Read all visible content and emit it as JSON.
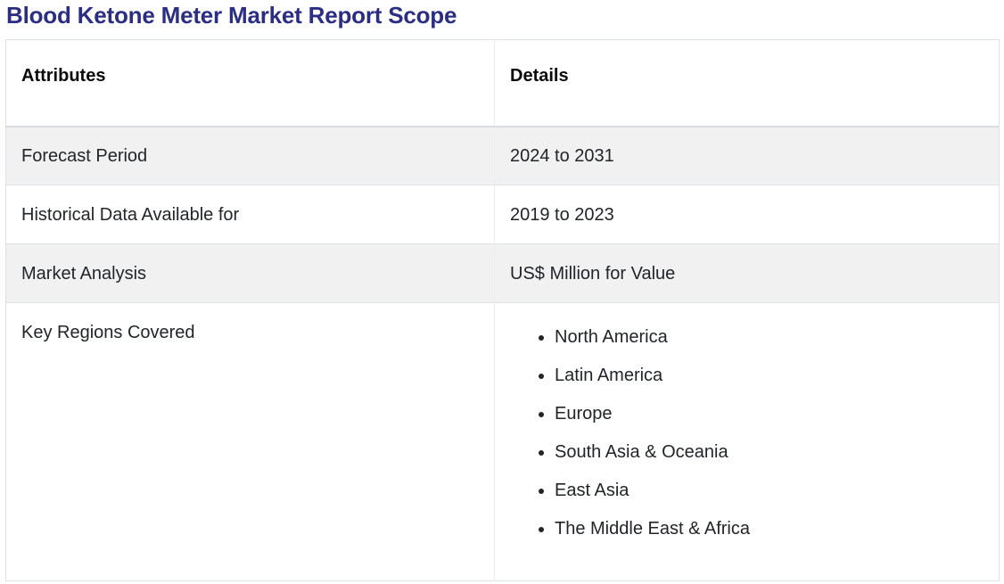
{
  "page": {
    "title": "Blood Ketone Meter Market Report Scope"
  },
  "colors": {
    "title_text": "#2b2e83",
    "row_stripe": "#f1f1f2",
    "table_border": "#dee2e6",
    "body_text": "#212529",
    "header_text": "#0b0b0b"
  },
  "table": {
    "headers": [
      "Attributes",
      "Details"
    ],
    "rows": [
      {
        "attribute": "Forecast Period",
        "detail": "2024 to 2031"
      },
      {
        "attribute": "Historical Data Available for",
        "detail": "2019 to 2023"
      },
      {
        "attribute": "Market Analysis",
        "detail": "US$ Million for Value"
      },
      {
        "attribute": "Key Regions Covered",
        "regions": [
          "North America",
          "Latin America",
          "Europe",
          "South Asia & Oceania",
          "East Asia",
          "The Middle East & Africa"
        ]
      }
    ]
  }
}
